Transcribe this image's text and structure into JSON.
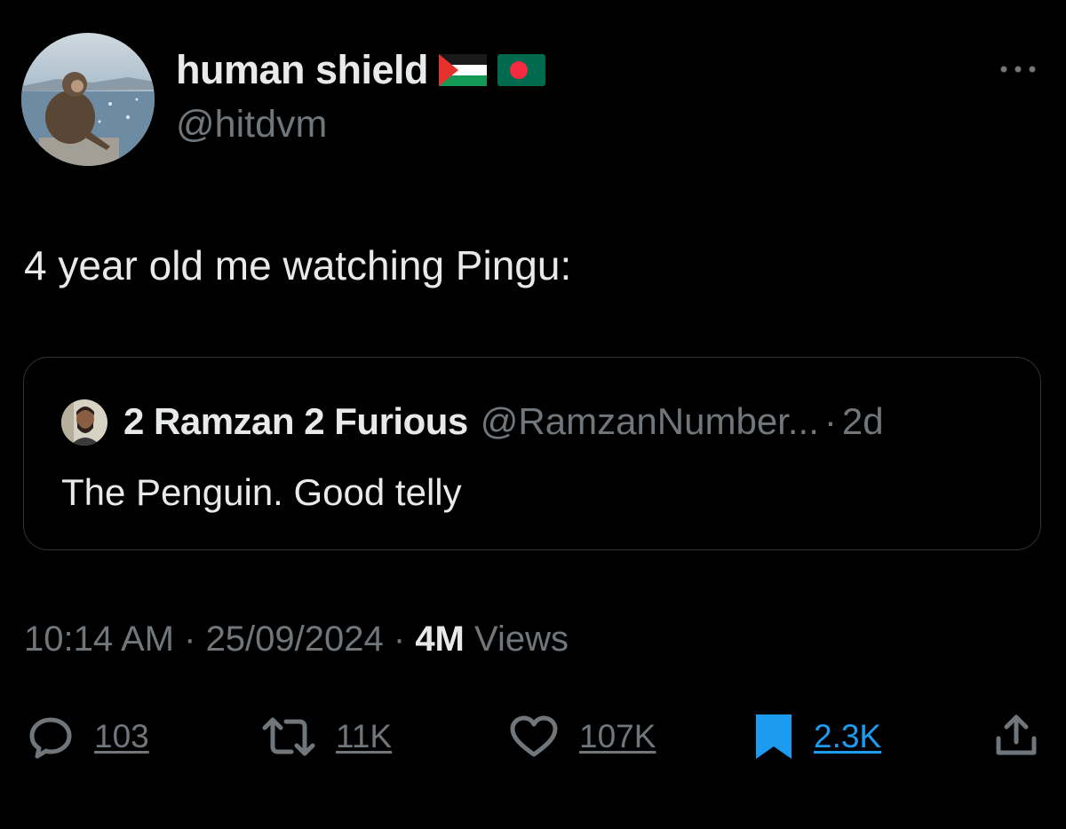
{
  "author": {
    "display_name": "human shield",
    "handle": "@hitdvm",
    "flags": [
      "palestine-flag",
      "bangladesh-flag"
    ]
  },
  "tweet": {
    "text": "4 year old me watching Pingu:"
  },
  "quote": {
    "display_name": "2 Ramzan 2 Furious",
    "handle": "@RamzanNumber...",
    "separator": "·",
    "time": "2d",
    "text": "The Penguin. Good telly"
  },
  "meta": {
    "time": "10:14 AM",
    "sep1": " · ",
    "date": "25/09/2024",
    "sep2": " · ",
    "views_count": "4M",
    "views_label": " Views"
  },
  "actions": {
    "replies": "103",
    "reposts": "11K",
    "likes": "107K",
    "bookmarks": "2.3K"
  },
  "icons": {
    "more": "more-horizontal-icon",
    "reply": "reply-icon",
    "repost": "repost-icon",
    "like": "heart-icon",
    "bookmark": "bookmark-icon",
    "share": "share-icon"
  },
  "colors": {
    "background": "#000000",
    "text_primary": "#e7e9ea",
    "text_secondary": "#71767b",
    "accent": "#1d9bf0",
    "border": "#2f3336"
  }
}
